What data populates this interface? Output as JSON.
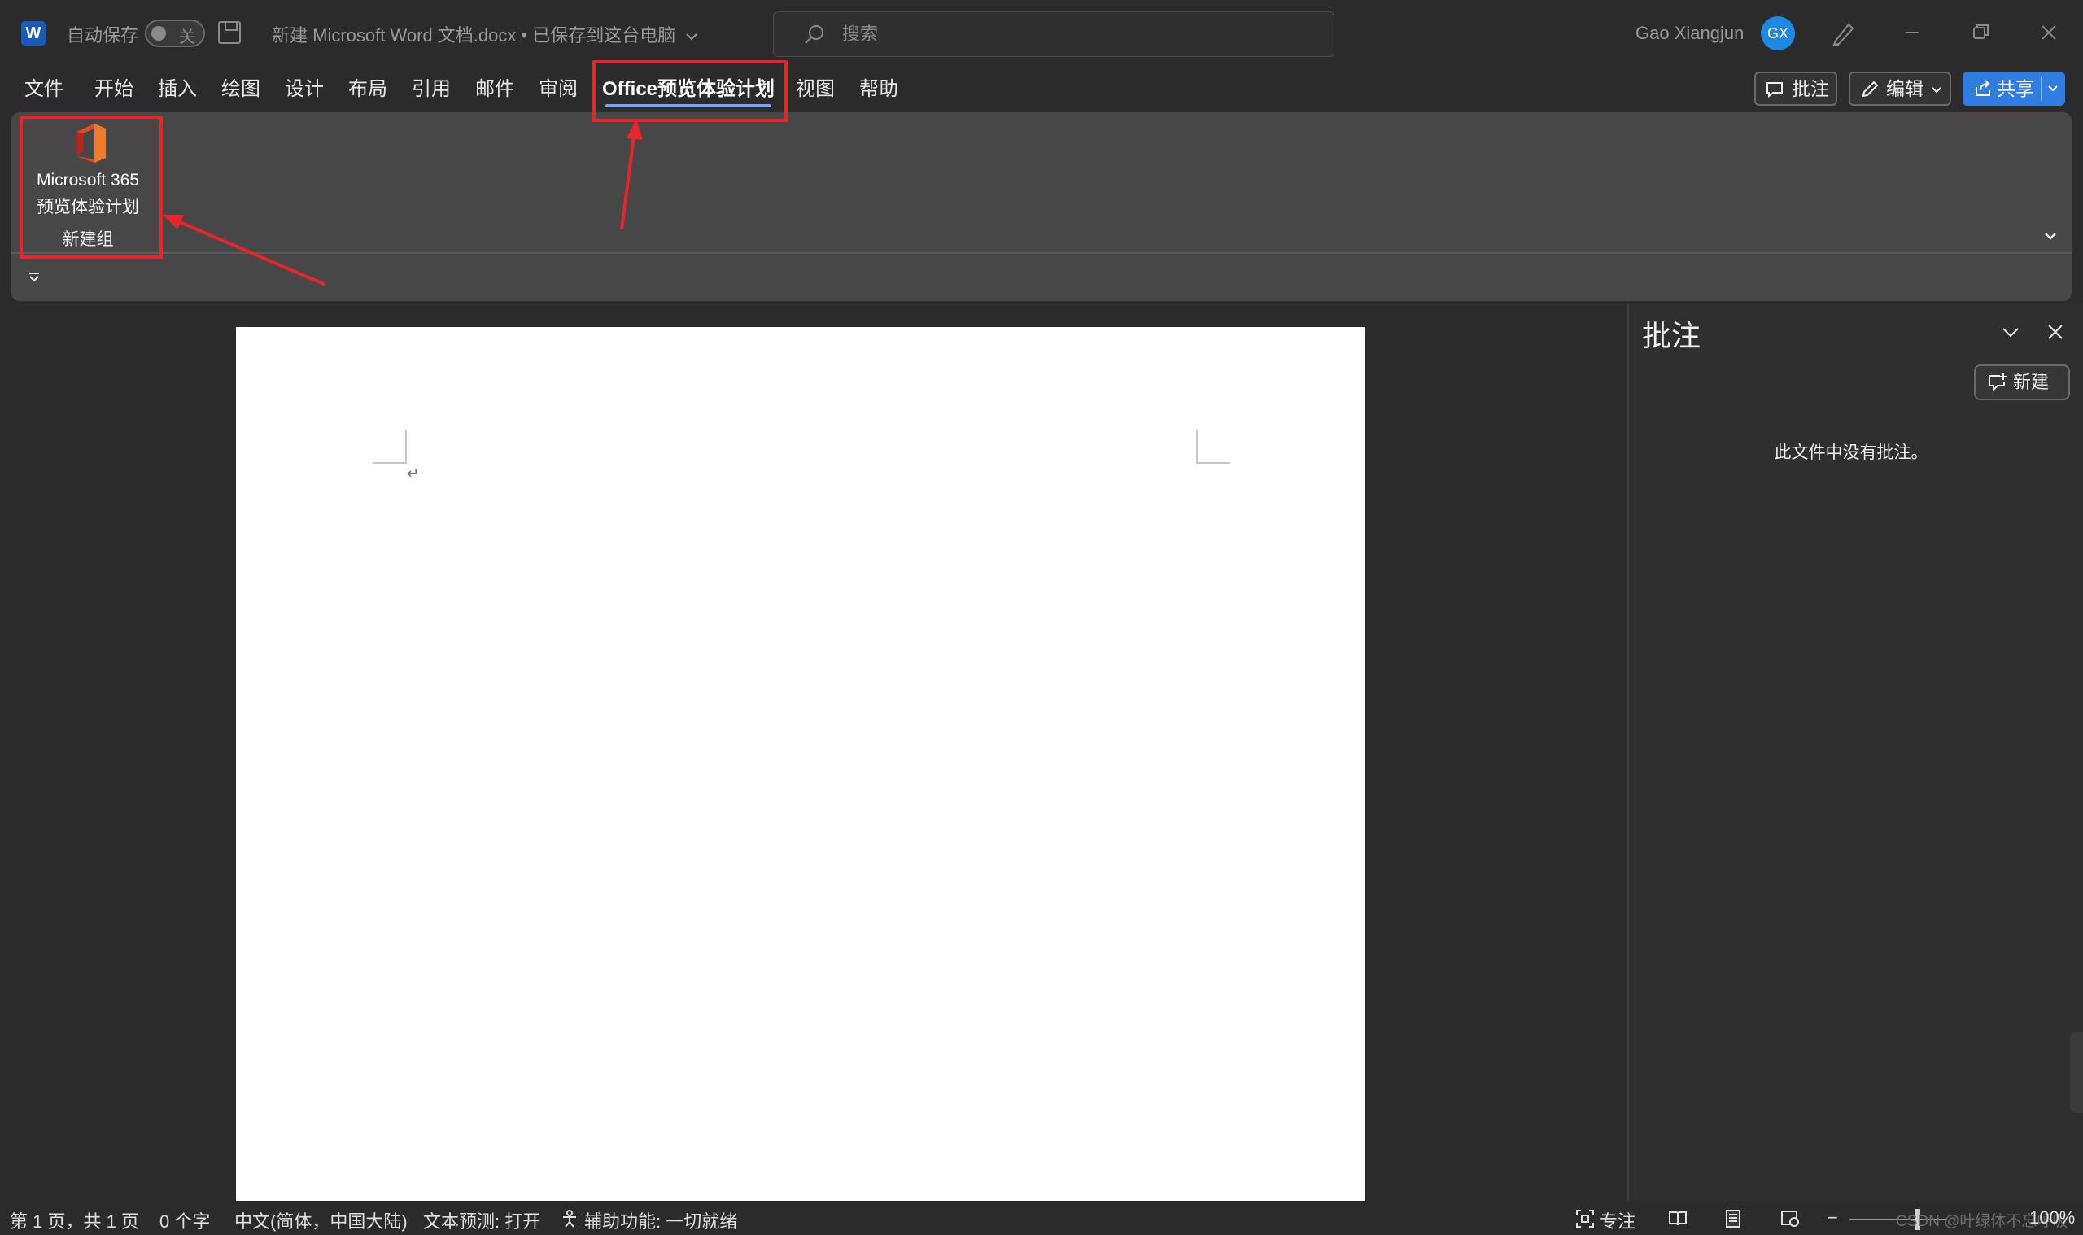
{
  "titlebar": {
    "autosave_label": "自动保存",
    "autosave_state": "关",
    "doc_title": "新建 Microsoft Word 文档.docx • 已保存到这台电脑",
    "search_placeholder": "搜索",
    "user_name": "Gao Xiangjun",
    "user_initials": "GX",
    "app_logo_letter": "W"
  },
  "tabs": [
    {
      "label": "文件"
    },
    {
      "label": "开始"
    },
    {
      "label": "插入"
    },
    {
      "label": "绘图"
    },
    {
      "label": "设计"
    },
    {
      "label": "布局"
    },
    {
      "label": "引用"
    },
    {
      "label": "邮件"
    },
    {
      "label": "审阅"
    },
    {
      "label": "Office预览体验计划",
      "active": true
    },
    {
      "label": "视图"
    },
    {
      "label": "帮助"
    }
  ],
  "header_buttons": {
    "comments": "批注",
    "editing": "编辑",
    "share": "共享"
  },
  "ribbon": {
    "button_line1": "Microsoft 365",
    "button_line2": "预览体验计划",
    "group_label": "新建组"
  },
  "comments_pane": {
    "title": "批注",
    "new_button": "新建",
    "empty_message": "此文件中没有批注。"
  },
  "statusbar": {
    "page": "第 1 页，共 1 页",
    "words": "0 个字",
    "language": "中文(简体，中国大陆)",
    "text_prediction": "文本预测: 打开",
    "accessibility": "辅助功能: 一切就绪",
    "focus": "专注",
    "zoom": "100%",
    "watermark": "CSDN @叶绿体不忘呼吸"
  },
  "colors": {
    "annotation_red": "#e8252a",
    "accent_blue": "#2f7de1",
    "active_tab_underline": "#7aa2ff"
  }
}
